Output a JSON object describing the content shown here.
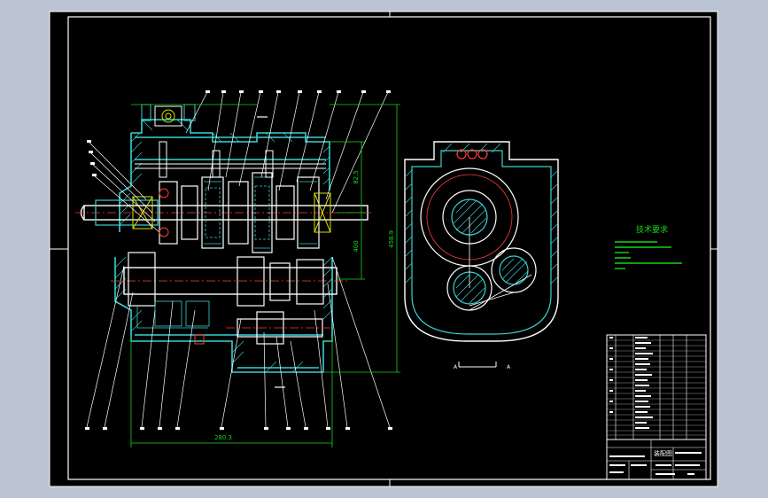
{
  "colors": {
    "background": "#b9c3d2",
    "paper": "#000000",
    "frame": "#ffffff",
    "outline": "#ffffff",
    "hatch": "#37d2d2",
    "dimension": "#19d419",
    "notes": "#19d419",
    "accent": "#e0e000",
    "hole": "#ff3b3b"
  },
  "drawing": {
    "dimensions": {
      "overall_length": "280.3",
      "overall_height": "458.9",
      "upper_height": "82.5",
      "center_distance": "400"
    },
    "side_view": {
      "section_mark": "A"
    },
    "technical_requirements": {
      "title": "技术要求"
    },
    "title_block": {
      "drawing_name": "装配图"
    }
  }
}
